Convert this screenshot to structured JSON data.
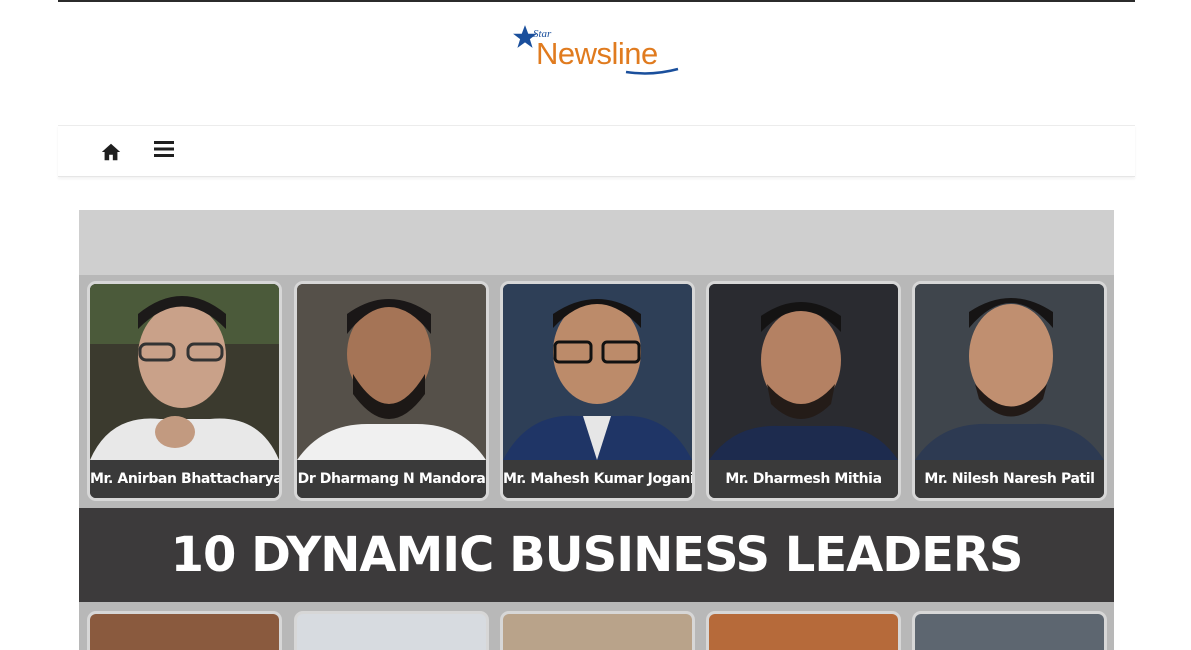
{
  "site": {
    "logo_small": "Star",
    "logo_main": "Newsline",
    "brand_orange": "#e07b1f",
    "brand_blue": "#1a4f9c"
  },
  "nav": {
    "home_icon": "home-icon",
    "menu_icon": "hamburger-menu-icon"
  },
  "banner": {
    "headline": "10 DYNAMIC BUSINESS LEADERS",
    "leaders_top": [
      {
        "name": "Mr. Anirban Bhattacharya"
      },
      {
        "name": "Dr Dharmang N Mandora"
      },
      {
        "name": "Mr. Mahesh Kumar Jogani"
      },
      {
        "name": "Mr. Dharmesh Mithia"
      },
      {
        "name": "Mr. Nilesh Naresh Patil"
      }
    ]
  }
}
